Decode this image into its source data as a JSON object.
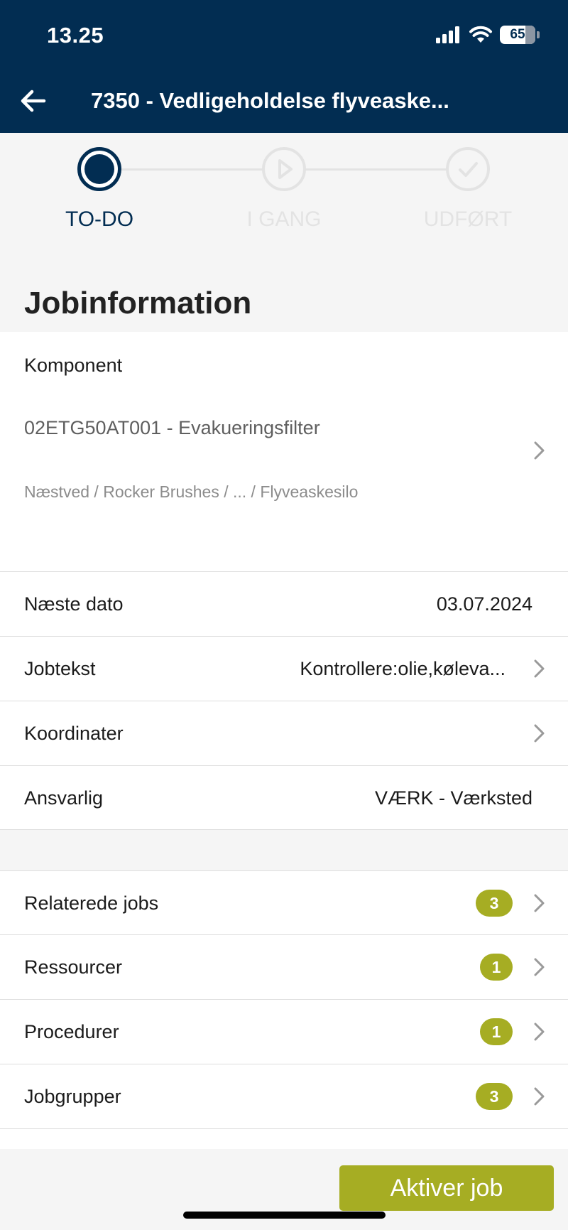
{
  "status_bar": {
    "time": "13.25",
    "battery": "65"
  },
  "header": {
    "title": "7350 - Vedligeholdelse flyveaske..."
  },
  "steps": [
    {
      "label": "TO-DO",
      "state": "active"
    },
    {
      "label": "I GANG",
      "state": "inactive"
    },
    {
      "label": "UDFØRT",
      "state": "inactive"
    }
  ],
  "section_title": "Jobinformation",
  "component": {
    "label": "Komponent",
    "value": "02ETG50AT001 - Evakueringsfilter",
    "path": "Næstved / Rocker Brushes / ... / Flyveaskesilo"
  },
  "info_rows": [
    {
      "label": "Næste dato",
      "value": "03.07.2024"
    },
    {
      "label": "Jobtekst",
      "value": "Kontrollere:olie,køleva..."
    },
    {
      "label": "Koordinater",
      "value": ""
    },
    {
      "label": "Ansvarlig",
      "value": "VÆRK - Værksted"
    }
  ],
  "link_rows": [
    {
      "label": "Relaterede jobs",
      "count": "3"
    },
    {
      "label": "Ressourcer",
      "count": "1"
    },
    {
      "label": "Procedurer",
      "count": "1"
    },
    {
      "label": "Jobgrupper",
      "count": "3"
    }
  ],
  "action_button": "Aktiver job",
  "colors": {
    "primary": "#022d52",
    "accent": "#a6ad23",
    "inactive": "#e3e3e3"
  }
}
